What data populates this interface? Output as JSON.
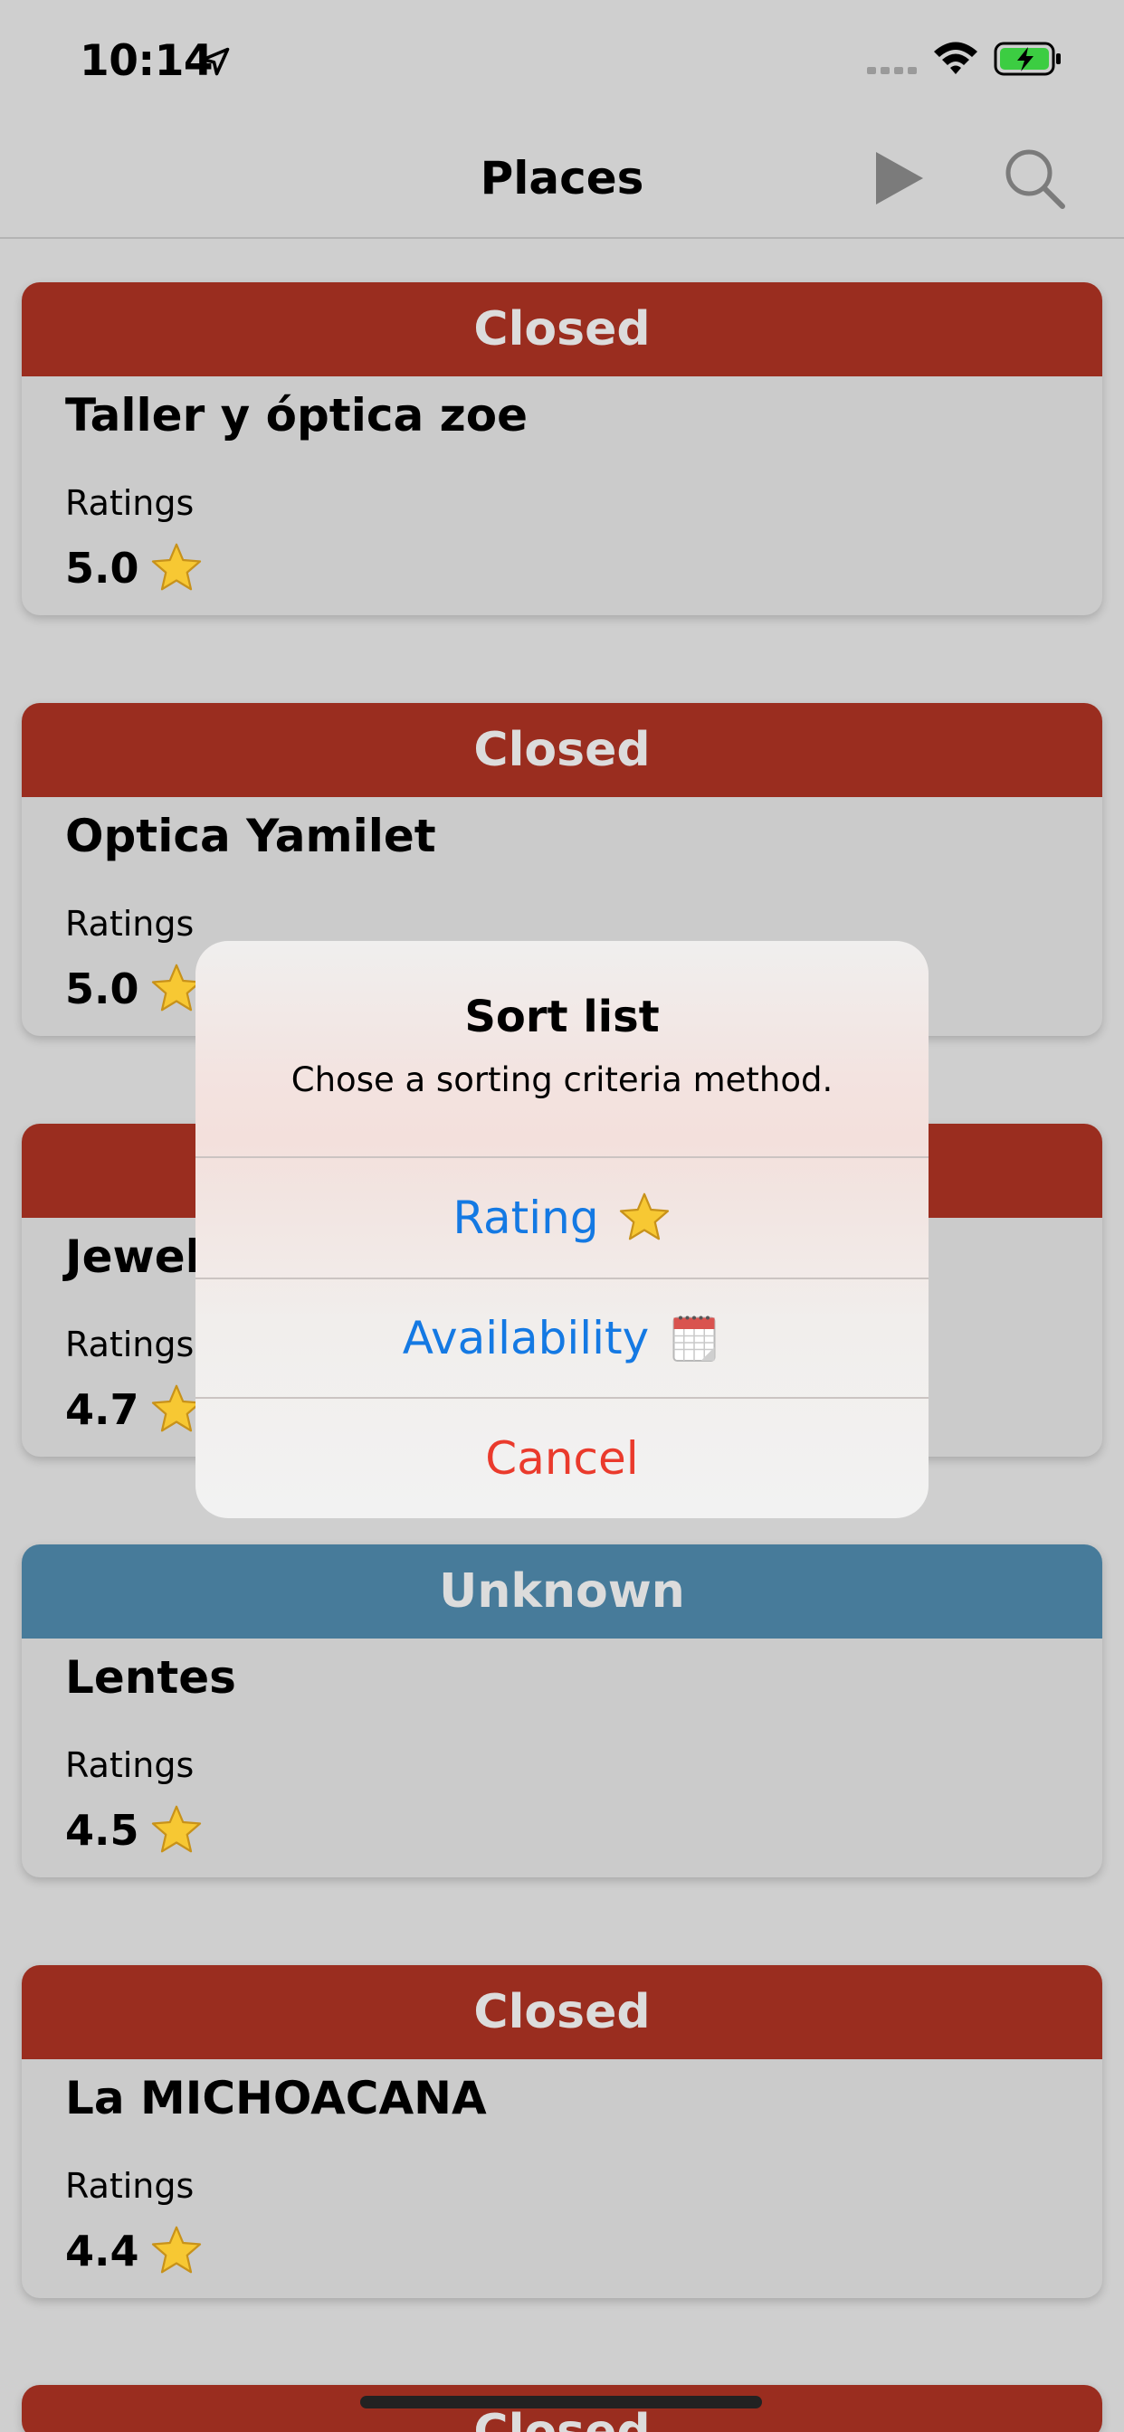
{
  "status_bar": {
    "time": "10:14"
  },
  "nav": {
    "title": "Places",
    "play_icon": "play-icon",
    "search_icon": "search-icon"
  },
  "colors": {
    "closed": "#9a2d1f",
    "unknown": "#477b9a",
    "link_blue": "#1479e3",
    "destructive_red": "#ea3a2c"
  },
  "places": [
    {
      "status": "Closed",
      "status_type": "closed",
      "name": "Taller y óptica zoe",
      "ratings_label": "Ratings",
      "rating": "5.0"
    },
    {
      "status": "Closed",
      "status_type": "closed",
      "name": "Optica Yamilet",
      "ratings_label": "Ratings",
      "rating": "5.0"
    },
    {
      "status": "",
      "status_type": "closed",
      "name": "Jewel",
      "ratings_label": "Ratings",
      "rating": "4.7"
    },
    {
      "status": "Unknown",
      "status_type": "unknown",
      "name": "Lentes",
      "ratings_label": "Ratings",
      "rating": "4.5"
    },
    {
      "status": "Closed",
      "status_type": "closed",
      "name": "La MICHOACANA",
      "ratings_label": "Ratings",
      "rating": "4.4"
    },
    {
      "status": "Closed",
      "status_type": "closed",
      "name": "",
      "ratings_label": "",
      "rating": ""
    }
  ],
  "alert": {
    "title": "Sort list",
    "message": "Chose a sorting criteria method.",
    "actions": [
      {
        "label": "Rating",
        "icon": "star-icon"
      },
      {
        "label": "Availability",
        "icon": "calendar-icon"
      },
      {
        "label": "Cancel"
      }
    ]
  }
}
